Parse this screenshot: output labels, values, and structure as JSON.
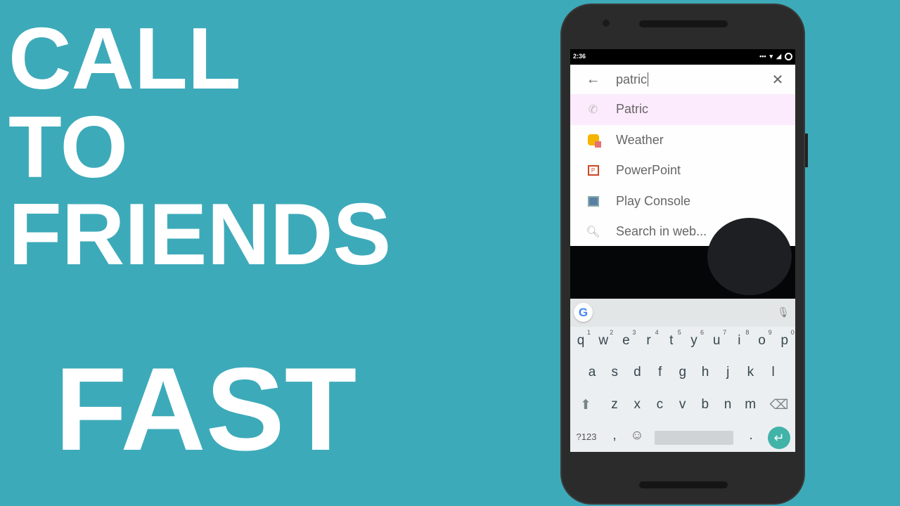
{
  "headline": {
    "line1": "CALL",
    "line2": "TO",
    "line3": "FRIENDS",
    "line4": "FAST"
  },
  "status_bar": {
    "time": "2:36"
  },
  "search": {
    "query": "patric",
    "back_icon": "arrow-left-icon",
    "clear_icon": "close-icon"
  },
  "results": [
    {
      "label": "Patric",
      "icon": "phone-icon",
      "highlighted": true
    },
    {
      "label": "Weather",
      "icon": "weather-app-icon"
    },
    {
      "label": "PowerPoint",
      "icon": "powerpoint-icon"
    },
    {
      "label": "Play Console",
      "icon": "play-console-icon"
    },
    {
      "label": "Search in web...",
      "icon": "search-icon"
    }
  ],
  "keyboard": {
    "row1": [
      "q",
      "w",
      "e",
      "r",
      "t",
      "y",
      "u",
      "i",
      "o",
      "p"
    ],
    "row1_hints": [
      "1",
      "2",
      "3",
      "4",
      "5",
      "6",
      "7",
      "8",
      "9",
      "0"
    ],
    "row2": [
      "a",
      "s",
      "d",
      "f",
      "g",
      "h",
      "j",
      "k",
      "l"
    ],
    "row3": [
      "z",
      "x",
      "c",
      "v",
      "b",
      "n",
      "m"
    ],
    "symbols": "?123",
    "comma": ",",
    "period": ".",
    "google": "G"
  },
  "colors": {
    "background": "#3daab9",
    "highlight": "#fcebfc",
    "enter": "#41b3a9"
  }
}
